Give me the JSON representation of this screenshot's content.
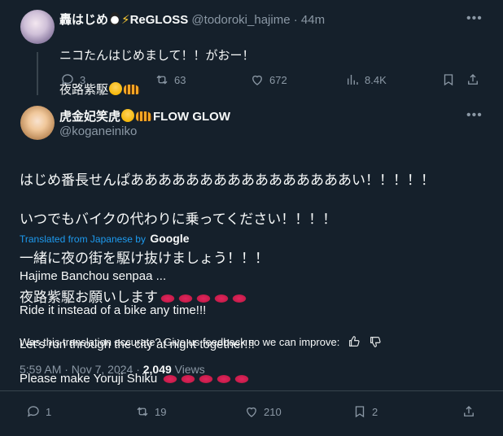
{
  "reply_tweet": {
    "name_prefix": "轟はじめ",
    "name_suffix": "ReGLOSS",
    "handle": "@todoroki_hajime",
    "separator": "·",
    "time": "44m",
    "text_line1": "ニコたんはじめまして！！がおー！",
    "text_line2": "夜路紫駆",
    "stats": {
      "replies": "3",
      "reposts": "63",
      "likes": "672",
      "views": "8.4K"
    }
  },
  "main_tweet": {
    "name": "虎金妃笑虎",
    "name_suffix": "FLOW GLOW",
    "handle": "@koganeiniko",
    "text_lines": [
      "はじめ番長せんぱああああああああああああああああい！！！！！",
      "いつでもバイクの代わりに乗ってください！！！！",
      "一緒に夜の街を駆け抜けましょう！！！",
      "夜路紫駆お願いします"
    ],
    "translated_from": "Translated from Japanese by",
    "translator": "Google",
    "translation_lines": [
      "Hajime Banchou senpaa ...",
      "Ride it instead of a bike any time!!!",
      "Let's run through the city at night together!!!",
      "Please make Yoruji Shiku"
    ],
    "feedback_text": "Was this translation accurate? Give us feedback so we can improve:",
    "timestamp": "5:59 AM · Nov 7, 2024 · ",
    "views_count": "2,049",
    "views_label": " Views",
    "stats": {
      "replies": "1",
      "reposts": "19",
      "likes": "210",
      "bookmarks": "2"
    }
  },
  "colors": {
    "background": "#15202b",
    "text": "#f7f9f9",
    "secondary": "#8b98a5",
    "accent": "#1d9bf0",
    "divider": "#38444d"
  }
}
